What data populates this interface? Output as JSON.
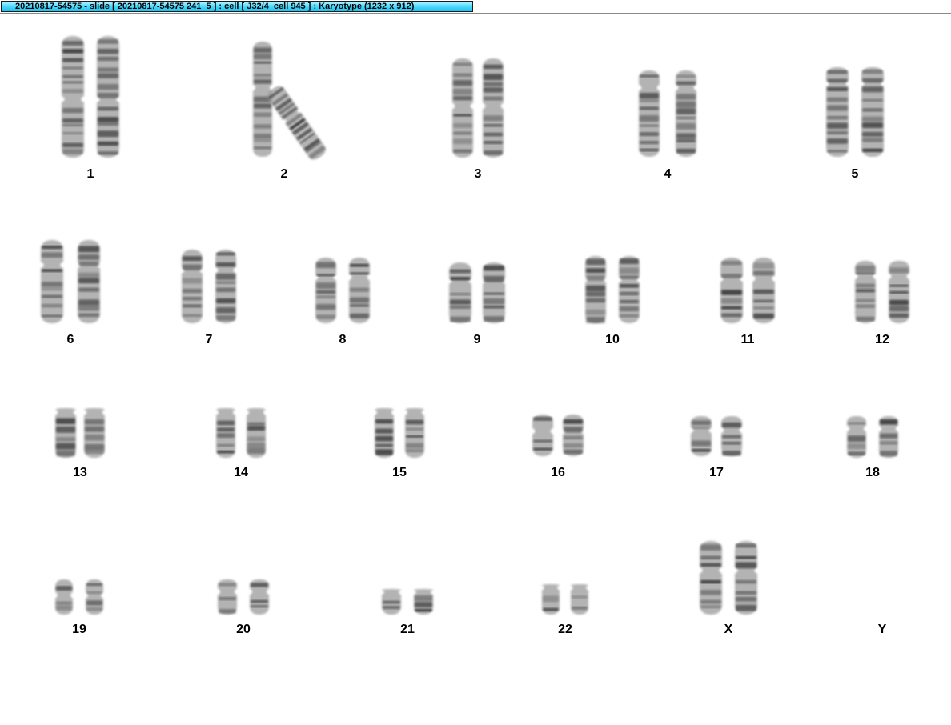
{
  "window": {
    "title": "20210817-54575 - slide [ 20210817-54575 241_5 ] : cell [ J32/4_cell 945 ] : Karyotype  (1232 x 912)"
  },
  "chromosomes": [
    {
      "label": "1"
    },
    {
      "label": "2"
    },
    {
      "label": "3"
    },
    {
      "label": "4"
    },
    {
      "label": "5"
    },
    {
      "label": "6"
    },
    {
      "label": "7"
    },
    {
      "label": "8"
    },
    {
      "label": "9"
    },
    {
      "label": "10"
    },
    {
      "label": "11"
    },
    {
      "label": "12"
    },
    {
      "label": "13"
    },
    {
      "label": "14"
    },
    {
      "label": "15"
    },
    {
      "label": "16"
    },
    {
      "label": "17"
    },
    {
      "label": "18"
    },
    {
      "label": "19"
    },
    {
      "label": "20"
    },
    {
      "label": "21"
    },
    {
      "label": "22"
    },
    {
      "label": "X"
    },
    {
      "label": "Y"
    }
  ]
}
